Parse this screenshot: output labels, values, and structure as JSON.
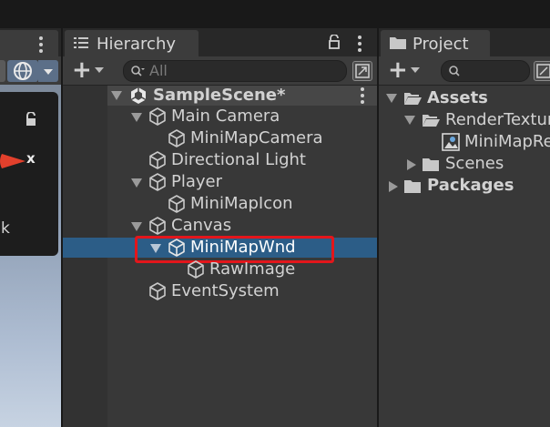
{
  "hierarchy": {
    "tab_title": "Hierarchy",
    "search_placeholder": "All",
    "scene": "SampleScene*",
    "items": [
      {
        "label": "Main Camera"
      },
      {
        "label": "MiniMapCamera"
      },
      {
        "label": "Directional Light"
      },
      {
        "label": "Player"
      },
      {
        "label": "MiniMapIcon"
      },
      {
        "label": "Canvas"
      },
      {
        "label": "MiniMapWnd",
        "selected": true
      },
      {
        "label": "RawImage"
      },
      {
        "label": "EventSystem"
      }
    ]
  },
  "project": {
    "tab_title": "Project",
    "tree": {
      "assets": "Assets",
      "render_textures": "RenderTextur",
      "minimap_texture": "MiniMapRe",
      "scenes": "Scenes",
      "packages": "Packages"
    }
  },
  "scene_view": {
    "axis_label": "x",
    "partial_label": "k"
  },
  "colors": {
    "selection": "#2c5d87",
    "highlight_box": "#e3161b",
    "panel_bg": "#383838",
    "tab_strip": "#282828"
  }
}
